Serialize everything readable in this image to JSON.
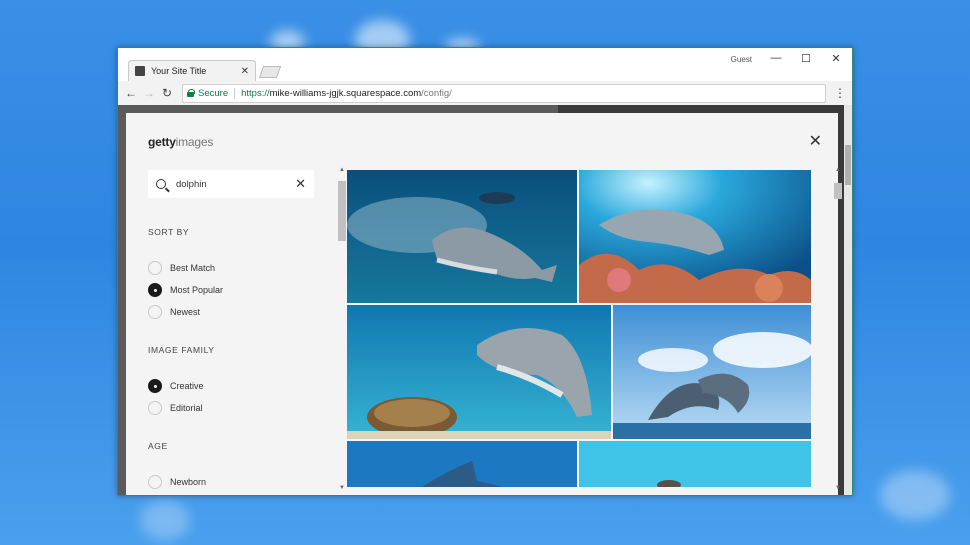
{
  "browser": {
    "tab_title": "Your Site Title",
    "tab_close": "✕",
    "profile": "Guest",
    "minimize": "—",
    "maximize": "☐",
    "close": "✕",
    "back": "←",
    "forward": "→",
    "reload": "↻",
    "secure_label": "Secure",
    "url_scheme": "https://",
    "url_host": "mike-williams-jgjk.squarespace.com",
    "url_path": "/config/",
    "menu": "⋮"
  },
  "modal": {
    "brand_bold": "getty",
    "brand_light": "images",
    "close": "✕",
    "search": {
      "value": "dolphin",
      "clear": "✕"
    },
    "sort_by": {
      "title": "SORT BY",
      "options": [
        "Best Match",
        "Most Popular",
        "Newest"
      ],
      "selected": "Most Popular"
    },
    "image_family": {
      "title": "IMAGE FAMILY",
      "options": [
        "Creative",
        "Editorial"
      ],
      "selected": "Creative"
    },
    "age": {
      "title": "AGE",
      "options": [
        "Newborn"
      ]
    }
  },
  "colors": {
    "desktop": "#2f86e0",
    "secure_green": "#0b8043",
    "ocean_deep": "#0c5a8c",
    "ocean_light": "#3fc3e6",
    "sky": "#5aa7e3"
  }
}
